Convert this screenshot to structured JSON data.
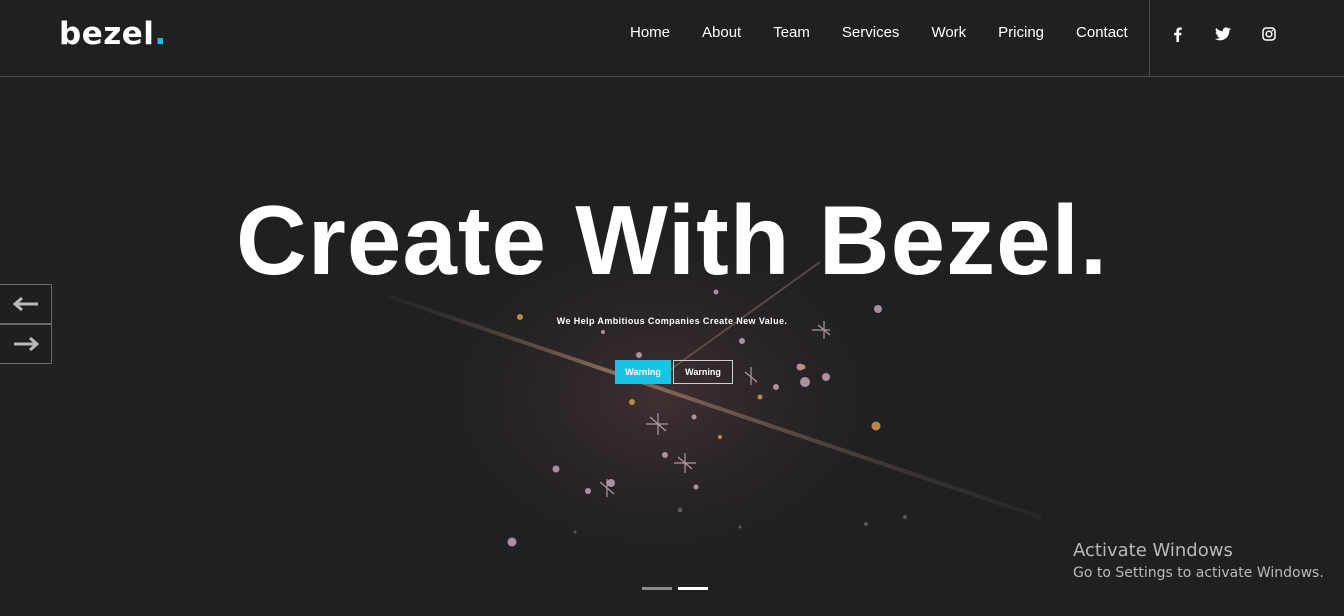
{
  "brand": {
    "name": "bezel",
    "dot": ".",
    "accent": "#19c3e6"
  },
  "nav": {
    "items": [
      {
        "label": "Home"
      },
      {
        "label": "About"
      },
      {
        "label": "Team"
      },
      {
        "label": "Services"
      },
      {
        "label": "Work"
      },
      {
        "label": "Pricing"
      },
      {
        "label": "Contact"
      }
    ]
  },
  "social": [
    {
      "icon": "facebook-icon"
    },
    {
      "icon": "twitter-icon"
    },
    {
      "icon": "instagram-icon"
    }
  ],
  "hero": {
    "headline": "Create With Bezel.",
    "subheadline": "We Help Ambitious Companies Create New Value.",
    "primary_button": "Warning",
    "secondary_button": "Warning",
    "slides_total": 2,
    "slides_active": 2
  },
  "arrows": {
    "prev_icon": "arrow-left-icon",
    "next_icon": "arrow-right-icon"
  },
  "watermark": {
    "title": "Activate Windows",
    "subtitle": "Go to Settings to activate Windows."
  },
  "colors": {
    "background": "#1f2022",
    "accent": "#19c3e6",
    "text": "#ffffff"
  }
}
